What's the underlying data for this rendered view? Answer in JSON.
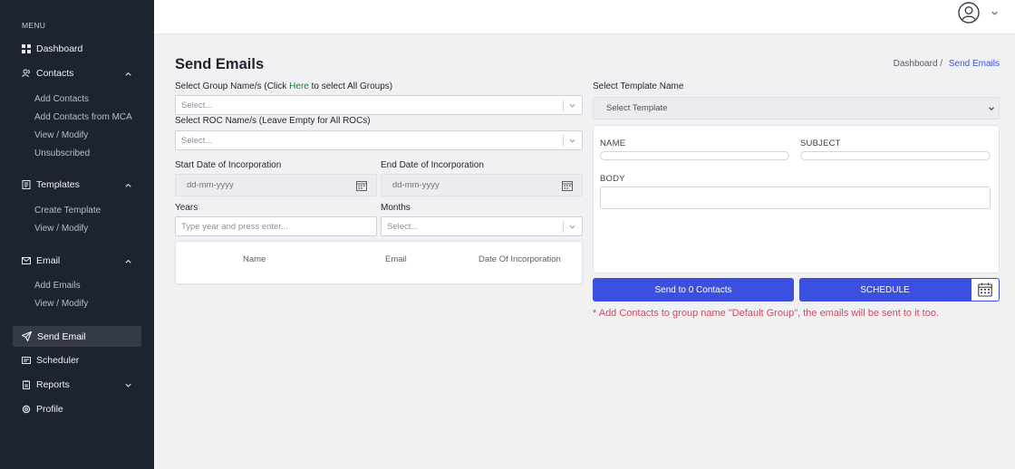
{
  "sidebar": {
    "menu_label": "MENU",
    "dashboard": "Dashboard",
    "contacts": {
      "label": "Contacts",
      "items": [
        "Add Contacts",
        "Add Contacts from MCA",
        "View / Modify",
        "Unsubscribed"
      ]
    },
    "templates": {
      "label": "Templates",
      "items": [
        "Create Template",
        "View / Modify"
      ]
    },
    "email": {
      "label": "Email",
      "items": [
        "Add Emails",
        "View / Modify"
      ]
    },
    "send_email": "Send Email",
    "scheduler": "Scheduler",
    "reports": "Reports",
    "profile": "Profile"
  },
  "header": {
    "page_title": "Send Emails",
    "breadcrumb": {
      "parent": "Dashboard",
      "separator": "/",
      "current": "Send Emails"
    }
  },
  "form": {
    "group_label_pre": "Select Group Name/s (Click ",
    "group_label_link": "Here",
    "group_label_post": " to select All Groups)",
    "group_placeholder": "Select...",
    "roc_label": "Select ROC Name/s (Leave Empty for All ROCs)",
    "roc_placeholder": "Select...",
    "start_date_label": "Start Date of Incorporation",
    "start_date_placeholder": "dd-mm-yyyy",
    "end_date_label": "End Date of Incorporation",
    "end_date_placeholder": "dd-mm-yyyy",
    "years_label": "Years",
    "years_placeholder": "Type year and press enter...",
    "months_label": "Months",
    "months_placeholder": "Select..."
  },
  "table": {
    "columns": [
      "Name",
      "Email",
      "Date Of Incorporation"
    ]
  },
  "template": {
    "label": "Select Template Name",
    "selected": "Select Template",
    "name_label": "NAME",
    "subject_label": "SUBJECT",
    "body_label": "BODY"
  },
  "actions": {
    "send_label": "Send to 0 Contacts",
    "schedule_label": "SCHEDULE"
  },
  "note": "* Add Contacts to group name \"Default Group\", the emails will be sent to it too.",
  "colors": {
    "sidebar_bg": "#1e2330",
    "primary": "#3b4fe0",
    "link_green": "#1a7f3e",
    "note_red": "#d6485a"
  }
}
